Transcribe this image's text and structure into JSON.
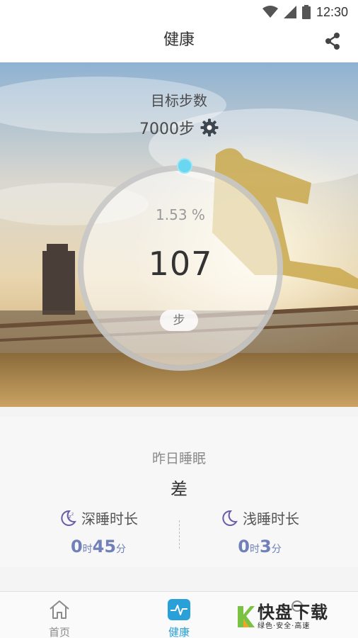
{
  "status_bar": {
    "time": "12:30"
  },
  "header": {
    "title": "健康"
  },
  "goal": {
    "label": "目标步数",
    "value": "7000步"
  },
  "progress": {
    "percent": "1.53 %",
    "steps": "107",
    "unit": "步",
    "fraction": 0.0153
  },
  "sleep": {
    "title": "昨日睡眠",
    "quality": "差",
    "deep": {
      "label": "深睡时长",
      "hours": "0",
      "hours_unit": "时",
      "minutes": "45",
      "minutes_unit": "分"
    },
    "light": {
      "label": "浅睡时长",
      "hours": "0",
      "hours_unit": "时",
      "minutes": "3",
      "minutes_unit": "分"
    }
  },
  "nav": {
    "home": "首页",
    "health": "健康",
    "third": ""
  },
  "watermark": {
    "brand": "快盘下载",
    "slogan": "绿色·安全·高速"
  },
  "colors": {
    "accent": "#2aa0d8",
    "progress_dot": "#6ad6f0",
    "sleep_value": "#7080b8"
  }
}
